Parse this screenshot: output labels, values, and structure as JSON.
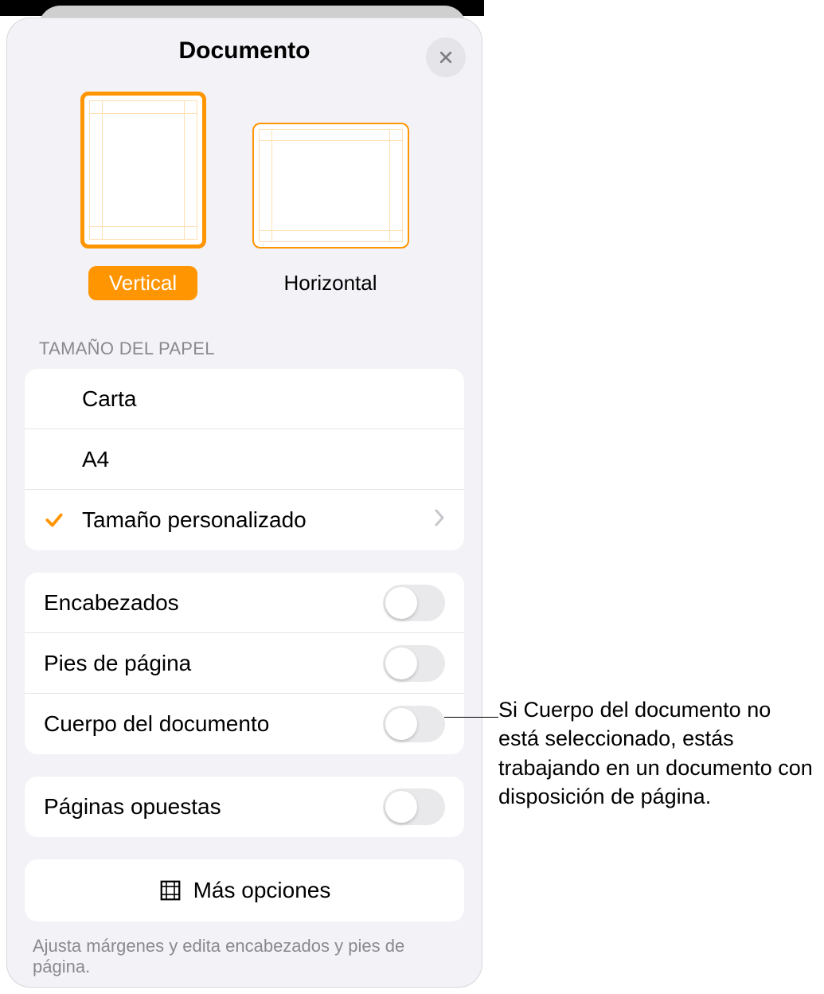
{
  "panel": {
    "title": "Documento"
  },
  "orientation": {
    "vertical": "Vertical",
    "horizontal": "Horizontal",
    "selected": "vertical"
  },
  "paper_size": {
    "header": "Tamaño del papel",
    "options": {
      "letter": "Carta",
      "a4": "A4",
      "custom": "Tamaño personalizado"
    },
    "selected": "custom"
  },
  "toggles": {
    "headers": {
      "label": "Encabezados",
      "on": false
    },
    "footers": {
      "label": "Pies de página",
      "on": false
    },
    "body": {
      "label": "Cuerpo del documento",
      "on": false
    },
    "facing": {
      "label": "Páginas opuestas",
      "on": false
    }
  },
  "more": {
    "label": "Más opciones"
  },
  "footer_note": "Ajusta márgenes y edita encabezados y pies de página.",
  "callout": "Si Cuerpo del documento no está seleccionado, estás trabajando en un documento con disposición de página.",
  "colors": {
    "accent": "#ff9500"
  }
}
